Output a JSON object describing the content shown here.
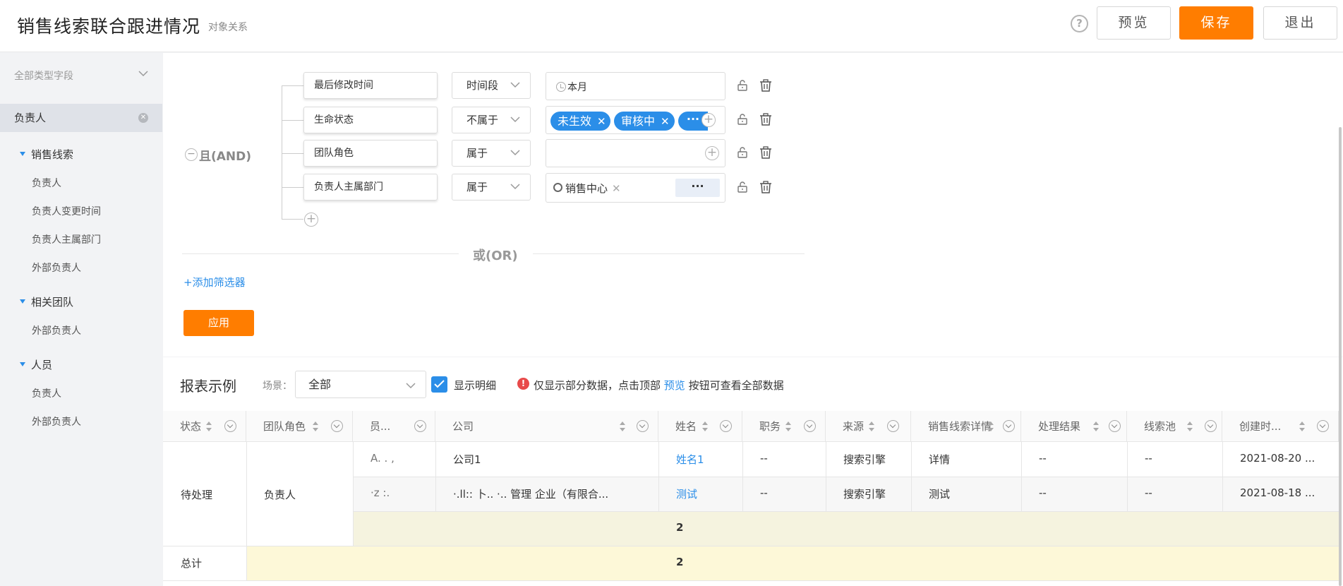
{
  "header": {
    "title": "销售线索联合跟进情况",
    "subtitle": "对象关系",
    "help_icon": "question-circle-icon",
    "preview_label": "预览",
    "save_label": "保存",
    "exit_label": "退出",
    "accent_color": "#ff7d00"
  },
  "sidebar": {
    "field_type_placeholder": "全部类型字段",
    "selected_field": "负责人",
    "groups": [
      {
        "label": "销售线索",
        "items": [
          "负责人",
          "负责人变更时间",
          "负责人主属部门",
          "外部负责人"
        ]
      },
      {
        "label": "相关团队",
        "items": [
          "外部负责人"
        ]
      },
      {
        "label": "人员",
        "items": [
          "负责人",
          "外部负责人"
        ]
      }
    ]
  },
  "filters": {
    "logic_label": "且(AND)",
    "rows": [
      {
        "field": "最后修改时间",
        "operator": "时间段",
        "value": "本月"
      },
      {
        "field": "生命状态",
        "operator": "不属于",
        "tags": [
          "未生效",
          "审核中"
        ],
        "more": "···"
      },
      {
        "field": "团队角色",
        "operator": "属于",
        "value": ""
      },
      {
        "field": "负责人主属部门",
        "operator": "属于",
        "dept_tag": "销售中心",
        "more": "···"
      }
    ],
    "or_label": "或(OR)",
    "add_filter_label": "+添加筛选器",
    "apply_label": "应用"
  },
  "report": {
    "title": "报表示例",
    "scene_label": "场景：",
    "scene_value": "全部",
    "show_detail_label": "显示明细",
    "show_detail_checked": true,
    "notice_prefix": "仅显示部分数据，点击顶部",
    "notice_link": "预览",
    "notice_suffix": "按钮可查看全部数据",
    "columns": [
      "状态",
      "团队角色",
      "员...",
      "公司",
      "姓名",
      "职务",
      "来源",
      "销售线索详情",
      "处理结果",
      "线索池",
      "创建时..."
    ],
    "group_status": "待处理",
    "group_role": "负责人",
    "rows": [
      {
        "member": "A. . ,",
        "company": "公司1",
        "name": "姓名1",
        "title": "--",
        "source": "搜索引擎",
        "detail": "详情",
        "result": "--",
        "pool": "--",
        "created": "2021-08-20 ..."
      },
      {
        "member": "·z :.",
        "company": "·.ll:: 卜.. ·.. 管理 企业（有限合...",
        "name": "测试",
        "title": "--",
        "source": "搜索引擎",
        "detail": "测试",
        "result": "--",
        "pool": "--",
        "created": "2021-08-18 ..."
      }
    ],
    "subtotal": "2",
    "total_label": "总计",
    "total": "2"
  }
}
